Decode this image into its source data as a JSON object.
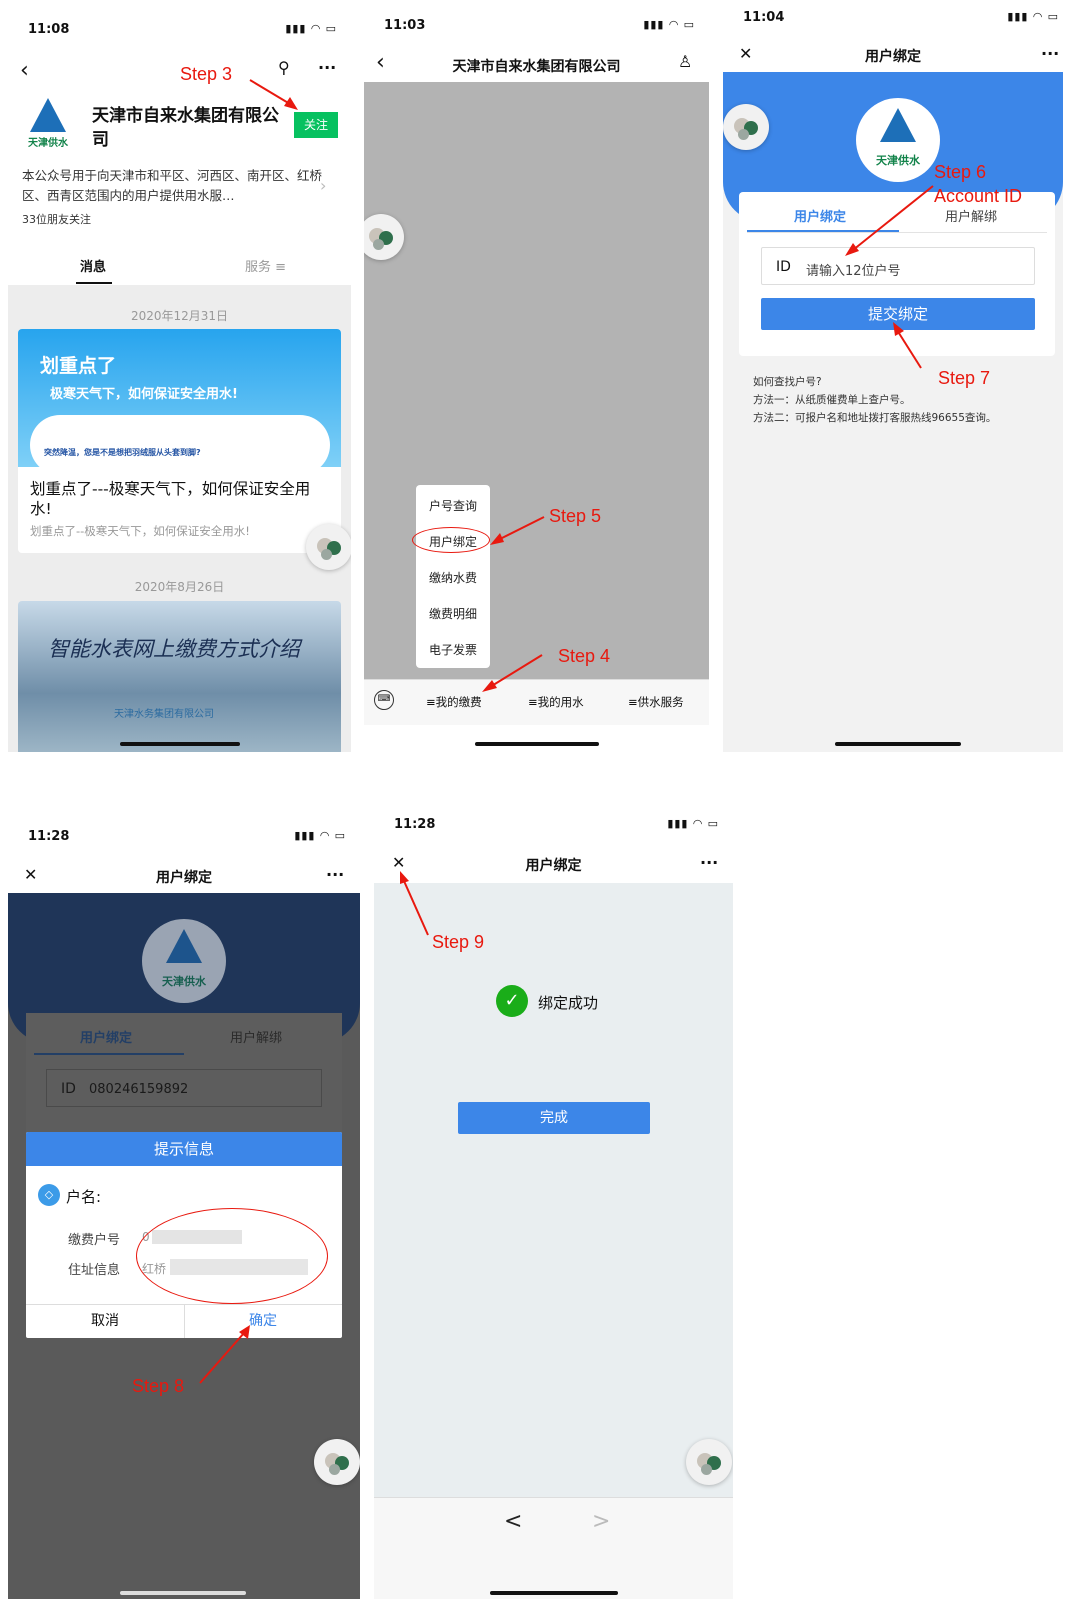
{
  "p1": {
    "time": "11:08",
    "step": "Step 3",
    "org": "天津市自来水集团有限公司",
    "follow": "关注",
    "logo_text": "天津供水",
    "desc": "本公众号用于向天津市和平区、河西区、南开区、红桥区、西青区范围内的用户提供用水服…",
    "friends": "33位朋友关注",
    "tab_msg": "消息",
    "tab_svc": "服务 ≡",
    "date1": "2020年12月31日",
    "banner1_title": "划重点了",
    "banner1_sub": "极寒天气下，如何保证安全用水!",
    "banner1_small": "突然降温，您是不是想把羽绒服从头套到脚?",
    "art1_title": "划重点了---极寒天气下，如何保证安全用水!",
    "art1_sub": "划重点了--极寒天气下，如何保证安全用水!",
    "date2": "2020年8月26日",
    "banner2_title": "智能水表网上缴费方式介绍",
    "banner2_sub": "天津水务集团有限公司"
  },
  "p2": {
    "time": "11:03",
    "title": "天津市自来水集团有限公司",
    "menu": [
      "户号查询",
      "用户绑定",
      "缴纳水费",
      "缴费明细",
      "电子发票"
    ],
    "step5": "Step 5",
    "step4": "Step 4",
    "bottom": [
      "≡我的缴费",
      "≡我的用水",
      "≡供水服务"
    ]
  },
  "p3": {
    "time": "11:04",
    "title": "用户绑定",
    "logo_text": "天津供水",
    "tab1": "用户绑定",
    "tab2": "用户解绑",
    "id_label": "ID",
    "placeholder": "请输入12位户号",
    "submit": "提交绑定",
    "step6": "Step 6",
    "acct": "Account ID",
    "step7": "Step 7",
    "help1": "如何查找户号?",
    "help2": "方法一：从纸质催费单上查户号。",
    "help3": "方法二：可报户名和地址拨打客服热线96655查询。"
  },
  "p4": {
    "time": "11:28",
    "title": "用户绑定",
    "logo_text": "天津供水",
    "tab1": "用户绑定",
    "tab2": "用户解绑",
    "id_label": "ID",
    "id_value": "080246159892",
    "dlg_title": "提示信息",
    "name_label": "户名:",
    "acct_label": "缴费户号",
    "acct_val": "0",
    "addr_label": "住址信息",
    "addr_val": "红桥",
    "cancel": "取消",
    "ok": "确定",
    "step8": "Step 8"
  },
  "p5": {
    "time": "11:28",
    "title": "用户绑定",
    "step9": "Step 9",
    "success": "绑定成功",
    "done": "完成",
    "back": "<",
    "fwd": ">"
  },
  "colors": {
    "blue": "#3c86e8",
    "green": "#07c160",
    "red": "#e8190f"
  }
}
